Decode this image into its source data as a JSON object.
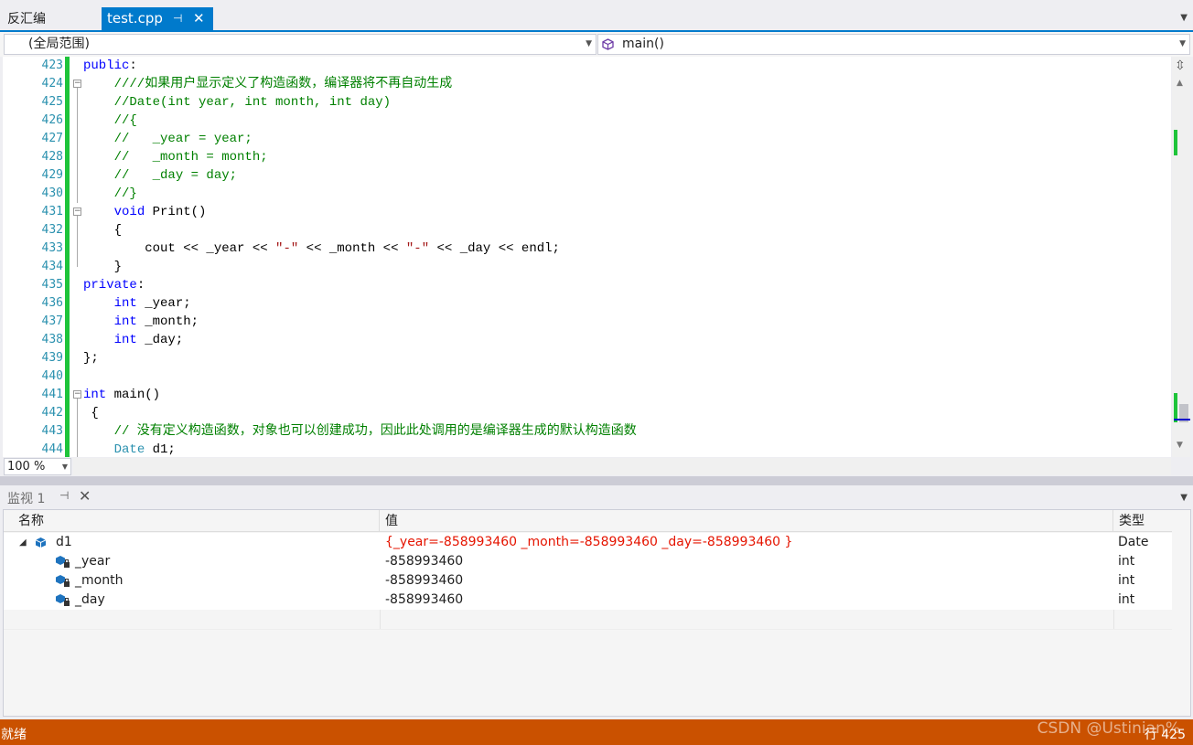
{
  "tabs": {
    "inactive_label": "反汇编",
    "active_label": "test.cpp",
    "pin_glyph": "⊣",
    "close_glyph": "✕"
  },
  "navbar": {
    "scope": "(全局范围)",
    "member": "main()"
  },
  "editor": {
    "line_numbers": [
      "423",
      "424",
      "425",
      "426",
      "427",
      "428",
      "429",
      "430",
      "431",
      "432",
      "433",
      "434",
      "435",
      "436",
      "437",
      "438",
      "439",
      "440",
      "441",
      "442",
      "443",
      "444"
    ],
    "zoom": "100 %"
  },
  "watch": {
    "title": "监视 1",
    "headers": {
      "name": "名称",
      "value": "值",
      "type": "类型"
    },
    "rows": [
      {
        "name": "d1",
        "value": "{_year=-858993460 _month=-858993460 _day=-858993460 }",
        "type": "Date"
      },
      {
        "name": "_year",
        "value": "-858993460",
        "type": "int"
      },
      {
        "name": "_month",
        "value": "-858993460",
        "type": "int"
      },
      {
        "name": "_day",
        "value": "-858993460",
        "type": "int"
      }
    ]
  },
  "status": {
    "left": "就绪",
    "right": "行 425"
  },
  "watermark": "CSDN @Ustinian%",
  "colors": {
    "accent": "#007acc",
    "status_bar": "#ca5100",
    "change_bar": "#1ec43a",
    "keyword": "#0000ff",
    "comment": "#008000",
    "string": "#a31515",
    "type": "#2b91af",
    "changed_value": "#e51400"
  }
}
